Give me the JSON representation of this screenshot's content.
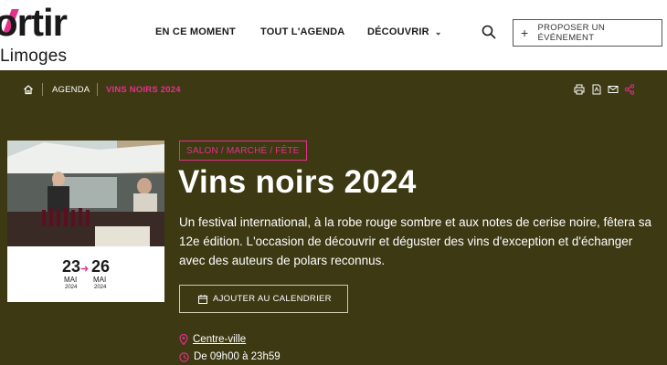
{
  "header": {
    "logo_top": "ortir",
    "logo_bottom": "Limoges",
    "nav": [
      {
        "label": "EN CE MOMENT"
      },
      {
        "label": "TOUT L'AGENDA"
      },
      {
        "label": "DÉCOUVRIR"
      }
    ],
    "propose_label": "PROPOSER UN ÉVÉNEMENT"
  },
  "breadcrumb": {
    "items": [
      "AGENDA",
      "VINS NOIRS 2024"
    ]
  },
  "event": {
    "category": "SALON / MARCHÉ / FÊTE",
    "title": "Vins noirs 2024",
    "description": "Un festival international, à la robe rouge sombre et aux notes de cerise noire, fêtera sa 12e édition. L'occasion de découvrir et déguster des vins d'exception et d'échanger avec des auteurs de polars reconnus.",
    "calendar_label": "AJOUTER AU CALENDRIER",
    "location": "Centre-ville",
    "hours": "De 09h00 à 23h59",
    "date_start": {
      "day": "23",
      "month": "MAI",
      "year": "2024"
    },
    "date_end": {
      "day": "26",
      "month": "MAI",
      "year": "2024"
    }
  },
  "colors": {
    "background": "#3c3913",
    "accent": "#e5318b"
  }
}
